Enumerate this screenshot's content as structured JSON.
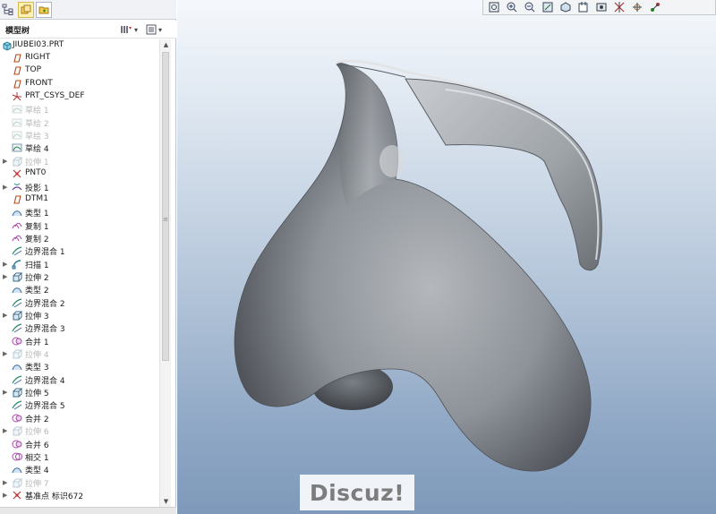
{
  "panel": {
    "title": "模型树",
    "tabs": [
      "model-tree-tab",
      "folder-tab"
    ],
    "root_label": "JIUBEI03.PRT"
  },
  "tree": [
    {
      "label": "RIGHT",
      "icon": "datum-plane-icon",
      "expand": false,
      "dim": false
    },
    {
      "label": "TOP",
      "icon": "datum-plane-icon",
      "expand": false,
      "dim": false
    },
    {
      "label": "FRONT",
      "icon": "datum-plane-icon",
      "expand": false,
      "dim": false
    },
    {
      "label": "PRT_CSYS_DEF",
      "icon": "csys-icon",
      "expand": false,
      "dim": false
    },
    {
      "label": "草绘 1",
      "icon": "sketch-icon",
      "expand": false,
      "dim": true
    },
    {
      "label": "草绘 2",
      "icon": "sketch-icon",
      "expand": false,
      "dim": true
    },
    {
      "label": "草绘 3",
      "icon": "sketch-icon",
      "expand": false,
      "dim": true
    },
    {
      "label": "草绘 4",
      "icon": "sketch-icon",
      "expand": false,
      "dim": false
    },
    {
      "label": "拉伸 1",
      "icon": "extrude-icon",
      "expand": true,
      "dim": true
    },
    {
      "label": "PNT0",
      "icon": "datum-point-icon",
      "expand": false,
      "dim": false
    },
    {
      "label": "投影 1",
      "icon": "project-icon",
      "expand": true,
      "dim": false
    },
    {
      "label": "DTM1",
      "icon": "datum-plane-icon",
      "expand": false,
      "dim": false
    },
    {
      "label": "类型 1",
      "icon": "surface-icon",
      "expand": false,
      "dim": false
    },
    {
      "label": "复制 1",
      "icon": "copy-icon",
      "expand": false,
      "dim": false
    },
    {
      "label": "复制 2",
      "icon": "copy-icon",
      "expand": false,
      "dim": false
    },
    {
      "label": "边界混合 1",
      "icon": "boundary-blend-icon",
      "expand": false,
      "dim": false
    },
    {
      "label": "扫描 1",
      "icon": "sweep-icon",
      "expand": true,
      "dim": false
    },
    {
      "label": "拉伸 2",
      "icon": "extrude-icon",
      "expand": true,
      "dim": false
    },
    {
      "label": "类型 2",
      "icon": "surface-icon",
      "expand": false,
      "dim": false
    },
    {
      "label": "边界混合 2",
      "icon": "boundary-blend-icon",
      "expand": false,
      "dim": false
    },
    {
      "label": "拉伸 3",
      "icon": "extrude-icon",
      "expand": true,
      "dim": false
    },
    {
      "label": "边界混合 3",
      "icon": "boundary-blend-icon",
      "expand": false,
      "dim": false
    },
    {
      "label": "合并 1",
      "icon": "merge-icon",
      "expand": false,
      "dim": false
    },
    {
      "label": "拉伸 4",
      "icon": "extrude-icon",
      "expand": true,
      "dim": true
    },
    {
      "label": "类型 3",
      "icon": "surface-icon",
      "expand": false,
      "dim": false
    },
    {
      "label": "边界混合 4",
      "icon": "boundary-blend-icon",
      "expand": false,
      "dim": false
    },
    {
      "label": "拉伸 5",
      "icon": "extrude-icon",
      "expand": true,
      "dim": false
    },
    {
      "label": "边界混合 5",
      "icon": "boundary-blend-icon",
      "expand": false,
      "dim": false
    },
    {
      "label": "合并 2",
      "icon": "merge-icon",
      "expand": false,
      "dim": false
    },
    {
      "label": "拉伸 6",
      "icon": "extrude-icon",
      "expand": true,
      "dim": true
    },
    {
      "label": "合并 6",
      "icon": "merge-icon",
      "expand": false,
      "dim": false
    },
    {
      "label": "相交 1",
      "icon": "intersect-icon",
      "expand": false,
      "dim": false
    },
    {
      "label": "类型 4",
      "icon": "surface-icon",
      "expand": false,
      "dim": false
    },
    {
      "label": "拉伸 7",
      "icon": "extrude-icon",
      "expand": true,
      "dim": true
    },
    {
      "label": "基准点 标识672",
      "icon": "datum-point-icon",
      "expand": true,
      "dim": false
    }
  ],
  "view_toolbar": [
    "refit-icon",
    "zoom-in-icon",
    "zoom-out-icon",
    "repaint-icon",
    "display-style-icon",
    "saved-views-icon",
    "view-manager-icon",
    "datum-display-icon",
    "spin-center-icon",
    "annotation-display-icon"
  ],
  "watermark": "Discuz!",
  "colors": {
    "accent_yellow": "#fff2b8",
    "dim_text": "#b8b8b8",
    "viewport_top": "#f5f8fc",
    "viewport_bottom": "#7f99ba",
    "model_gray": "#8e9399"
  }
}
